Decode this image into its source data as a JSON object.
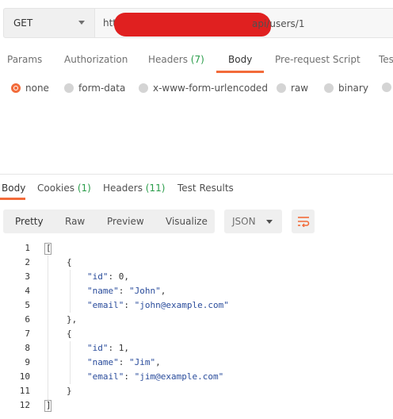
{
  "request": {
    "method": "GET",
    "url_prefix": "http",
    "url_suffix": "api/users/1"
  },
  "request_tabs": [
    {
      "label": "Params"
    },
    {
      "label": "Authorization"
    },
    {
      "label": "Headers",
      "count": "(7)"
    },
    {
      "label": "Body"
    },
    {
      "label": "Pre-request Script"
    },
    {
      "label": "Tes"
    }
  ],
  "body_modes": [
    {
      "label": "none",
      "selected": true
    },
    {
      "label": "form-data",
      "selected": false
    },
    {
      "label": "x-www-form-urlencoded",
      "selected": false
    },
    {
      "label": "raw",
      "selected": false
    },
    {
      "label": "binary",
      "selected": false
    }
  ],
  "response_tabs": [
    {
      "label": "Body"
    },
    {
      "label": "Cookies",
      "count": "(1)"
    },
    {
      "label": "Headers",
      "count": "(11)"
    },
    {
      "label": "Test Results"
    }
  ],
  "view_options": [
    "Pretty",
    "Raw",
    "Preview",
    "Visualize"
  ],
  "format": "JSON",
  "colors": {
    "accent": "#f26b3a",
    "count_green": "#2a9d4a",
    "key_blue": "#2b4d9c"
  },
  "code_lines": [
    {
      "n": "1",
      "text": "["
    },
    {
      "n": "2",
      "text": "{"
    },
    {
      "n": "3",
      "key": "\"id\"",
      "sep": ": ",
      "val": "0",
      "tail": ","
    },
    {
      "n": "4",
      "key": "\"name\"",
      "sep": ": ",
      "val": "\"John\"",
      "tail": ","
    },
    {
      "n": "5",
      "key": "\"email\"",
      "sep": ": ",
      "val": "\"john@example.com\"",
      "tail": ""
    },
    {
      "n": "6",
      "text": "},"
    },
    {
      "n": "7",
      "text": "{"
    },
    {
      "n": "8",
      "key": "\"id\"",
      "sep": ": ",
      "val": "1",
      "tail": ","
    },
    {
      "n": "9",
      "key": "\"name\"",
      "sep": ": ",
      "val": "\"Jim\"",
      "tail": ","
    },
    {
      "n": "10",
      "key": "\"email\"",
      "sep": ": ",
      "val": "\"jim@example.com\"",
      "tail": ""
    },
    {
      "n": "11",
      "text": "}"
    },
    {
      "n": "12",
      "text": "]"
    }
  ]
}
